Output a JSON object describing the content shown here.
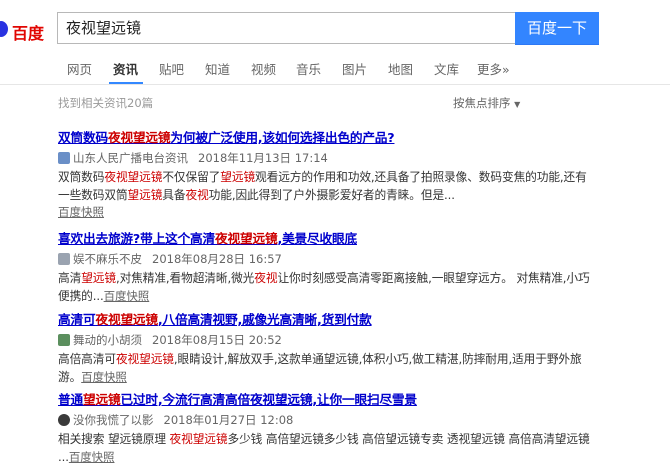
{
  "logo": {
    "text": "百度"
  },
  "search": {
    "query": "夜视望远镜",
    "button_label": "百度一下"
  },
  "tabs": [
    "网页",
    "资讯",
    "贴吧",
    "知道",
    "视频",
    "音乐",
    "图片",
    "地图",
    "文库",
    "更多»"
  ],
  "active_tab": "资讯",
  "results_count": "找到相关资讯20篇",
  "sort_label": "按焦点排序",
  "results": [
    {
      "title_pre": "双筒数码",
      "title_em": "夜视望远镜",
      "title_post": "为何被广泛使用,该如何选择出色的产品?",
      "source": "山东人民广播电台资讯",
      "time": "2018年11月13日 17:14",
      "body": [
        {
          "t": "双筒数码",
          "em": false
        },
        {
          "t": "夜视望远镜",
          "em": true
        },
        {
          "t": "不仅保留了",
          "em": false
        },
        {
          "t": "望远镜",
          "em": true
        },
        {
          "t": "观看远方的作用和功效,还具备了拍照录像、数码变焦的功能,还有一些数码双筒",
          "em": false
        },
        {
          "t": "望远镜",
          "em": true
        },
        {
          "t": "具备",
          "em": false
        },
        {
          "t": "夜视",
          "em": true
        },
        {
          "t": "功能,因此得到了户外摄影爱好者的青睐。但是...",
          "em": false
        }
      ],
      "snapshot": "百度快照"
    },
    {
      "title_pre": "喜欢出去旅游?带上这个高清",
      "title_em": "夜视望远镜",
      "title_post": ",美景尽收眼底",
      "source": "娱不麻乐不皮",
      "time": "2018年08月28日 16:57",
      "body": [
        {
          "t": "高清",
          "em": false
        },
        {
          "t": "望远镜",
          "em": true
        },
        {
          "t": ",对焦精准,看物超清晰,微光",
          "em": false
        },
        {
          "t": "夜视",
          "em": true
        },
        {
          "t": "让你时刻感受高清零距离接触,一眼望穿远方。 对焦精准,小巧便携的...",
          "em": false
        }
      ],
      "snapshot": "百度快照"
    },
    {
      "title_pre": "高清可",
      "title_em": "夜视望远镜",
      "title_post": ",八倍高清视野,戚像光高清晰,货到付款",
      "source": "舞动的小胡须",
      "time": "2018年08月15日 20:52",
      "body": [
        {
          "t": "高倍高清可",
          "em": false
        },
        {
          "t": "夜视望远镜",
          "em": true
        },
        {
          "t": ",眼睛设计,解放双手,这款单通望远镜,体积小巧,做工精湛,防摔耐用,适用于野外旅游。",
          "em": false
        }
      ],
      "snapshot": "百度快照"
    },
    {
      "title_pre": "普通",
      "title_em": "望远镜",
      "title_post": "已过时,今流行高清高倍夜视望远镜,让你一眼扫尽雪景",
      "source": "没你我慌了以影",
      "time": "2018年01月27日 12:08",
      "body": [
        {
          "t": "相关搜索 望远镜原理 ",
          "em": false
        },
        {
          "t": "夜视望远镜",
          "em": true
        },
        {
          "t": "多少钱 高倍望远镜多少钱 高倍望远镜专卖 透视望远镜 高倍高清望远镜 ...",
          "em": false
        }
      ],
      "snapshot": "百度快照"
    }
  ],
  "colors": {
    "accent": "#3385ff",
    "link": "#0000cc",
    "highlight": "#cc0000"
  }
}
